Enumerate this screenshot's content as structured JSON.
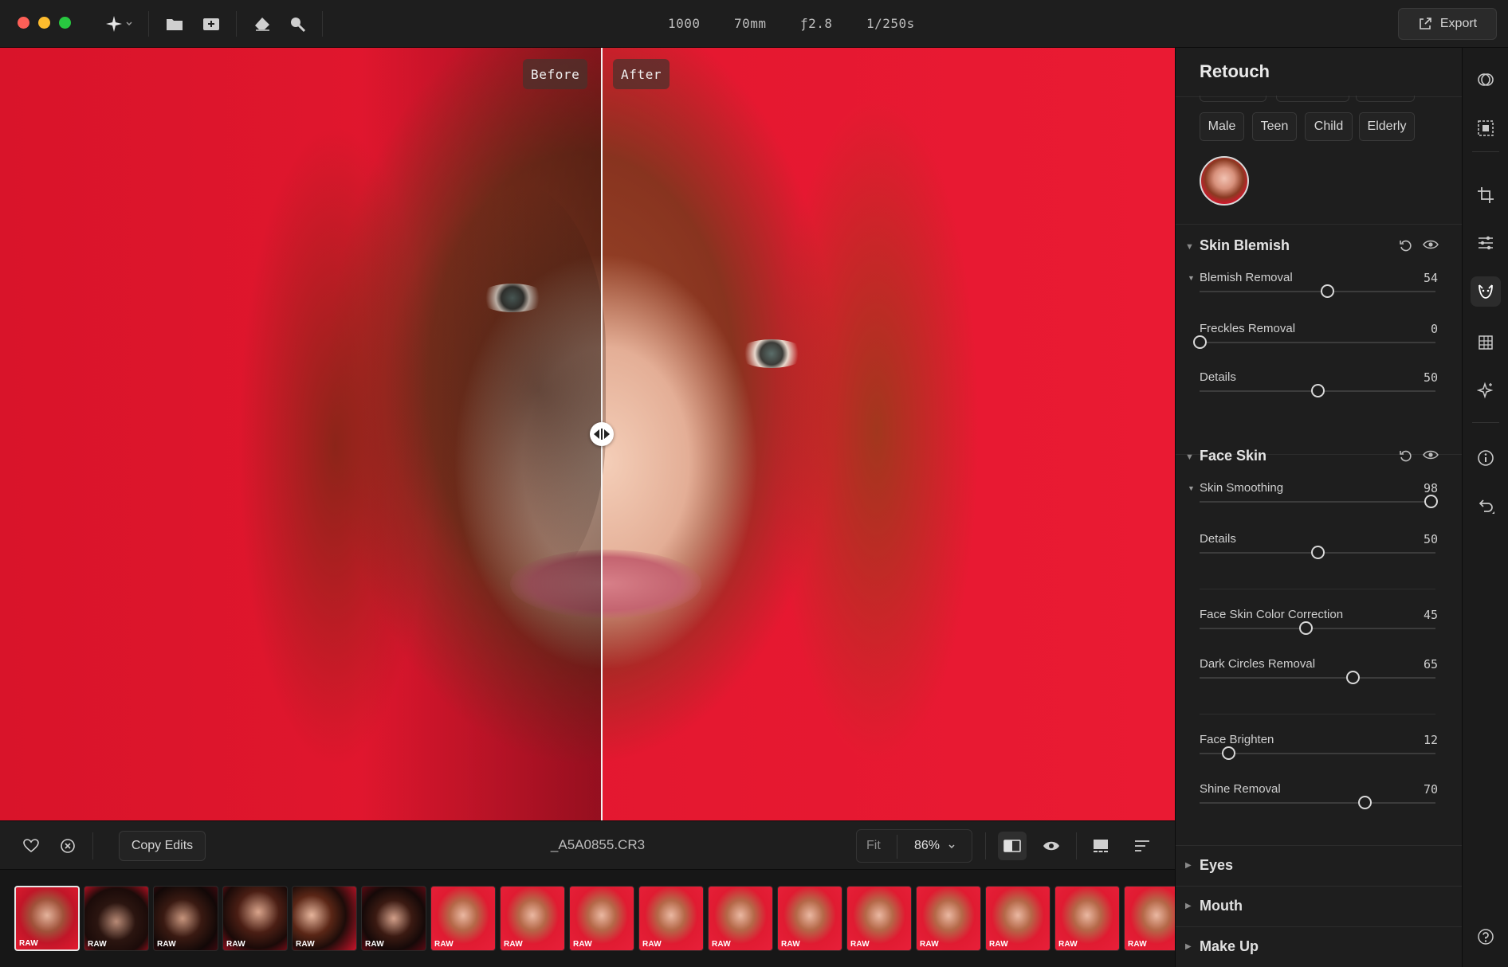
{
  "top_bar": {
    "meta": [
      "1000",
      "70mm",
      "ƒ2.8",
      "1/250s"
    ],
    "export_label": "Export"
  },
  "canvas": {
    "before_label": "Before",
    "after_label": "After"
  },
  "bottom_bar": {
    "copy_edits_label": "Copy Edits",
    "filename": "_A5A0855.CR3",
    "zoom_fit": "Fit",
    "zoom_value": "86%"
  },
  "filmstrip": {
    "badge": "RAW",
    "count": 17,
    "selected_index": 0
  },
  "panel": {
    "title": "Retouch",
    "age_chips": [
      "Male",
      "Teen",
      "Child",
      "Elderly"
    ],
    "skin_blemish": {
      "title": "Skin Blemish",
      "sliders": [
        {
          "label": "Blemish Removal",
          "value": "54",
          "fraction": 0.54,
          "expandable": true
        },
        {
          "label": "Freckles Removal",
          "value": "0",
          "fraction": 0.0,
          "expandable": false
        },
        {
          "label": "Details",
          "value": "50",
          "fraction": 0.5,
          "expandable": false
        }
      ]
    },
    "face_skin": {
      "title": "Face Skin",
      "sliders": [
        {
          "label": "Skin Smoothing",
          "value": "98",
          "fraction": 0.98,
          "expandable": true
        },
        {
          "label": "Details",
          "value": "50",
          "fraction": 0.5,
          "expandable": false
        },
        {
          "label": "Face Skin Color Correction",
          "value": "45",
          "fraction": 0.45,
          "expandable": false
        },
        {
          "label": "Dark Circles Removal",
          "value": "65",
          "fraction": 0.65,
          "expandable": false
        },
        {
          "label": "Face Brighten",
          "value": "12",
          "fraction": 0.12,
          "expandable": false
        },
        {
          "label": "Shine Removal",
          "value": "70",
          "fraction": 0.7,
          "expandable": false
        }
      ]
    },
    "collapsed_sections": [
      "Eyes",
      "Mouth",
      "Make Up"
    ]
  }
}
